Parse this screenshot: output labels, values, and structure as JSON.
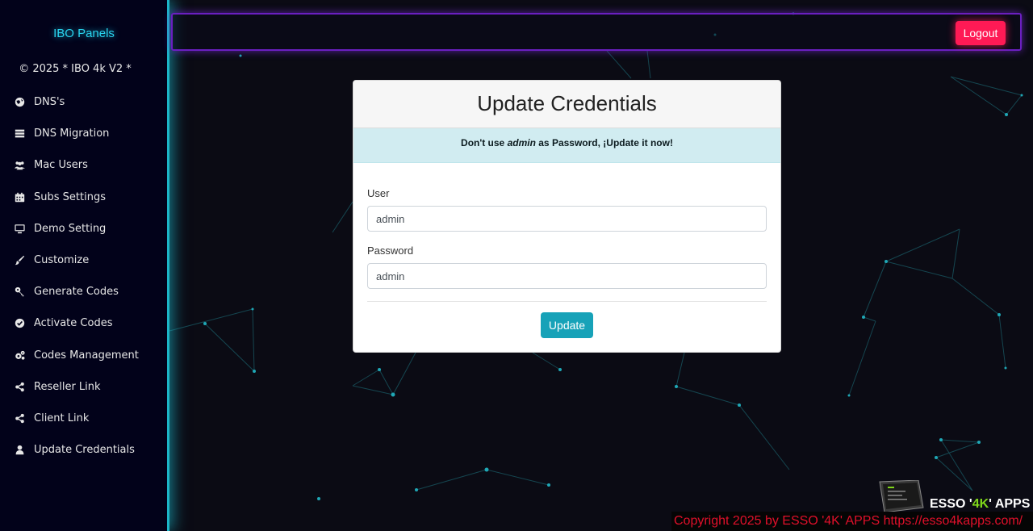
{
  "sidebar": {
    "brand": "IBO Panels",
    "subtitle": "© 2025 * IBO 4k V2 *",
    "items": [
      {
        "label": "DNS's",
        "icon": "globe-icon"
      },
      {
        "label": "DNS Migration",
        "icon": "server-icon"
      },
      {
        "label": "Mac Users",
        "icon": "users-icon"
      },
      {
        "label": "Subs Settings",
        "icon": "calendar-icon"
      },
      {
        "label": "Demo Setting",
        "icon": "monitor-icon"
      },
      {
        "label": "Customize",
        "icon": "brush-icon"
      },
      {
        "label": "Generate Codes",
        "icon": "key-icon"
      },
      {
        "label": "Activate Codes",
        "icon": "check-circle-icon"
      },
      {
        "label": "Codes Management",
        "icon": "cogs-icon"
      },
      {
        "label": "Reseller Link",
        "icon": "share-icon"
      },
      {
        "label": "Client Link",
        "icon": "share-icon"
      },
      {
        "label": "Update Credentials",
        "icon": "user-icon"
      }
    ]
  },
  "topbar": {
    "logout_label": "Logout"
  },
  "card": {
    "title": "Update Credentials",
    "alert": {
      "prefix": "Don't use ",
      "emph": "admin",
      "suffix": " as Password, ¡Update it now!"
    },
    "user_label": "User",
    "user_value": "admin",
    "password_label": "Password",
    "password_value": "admin",
    "update_label": "Update"
  },
  "footer": {
    "copyright": "Copyright 2025  by ESSO '4K' APPS https://esso4kapps.com/",
    "logo_prefix": "ESSO '",
    "logo_accent": "4K",
    "logo_suffix": "' APPS"
  },
  "colors": {
    "accent_cyan": "#1bb6c8",
    "logout_red": "#ff1a55",
    "update_teal": "#17a2b8",
    "footer_red": "#e0102a"
  }
}
